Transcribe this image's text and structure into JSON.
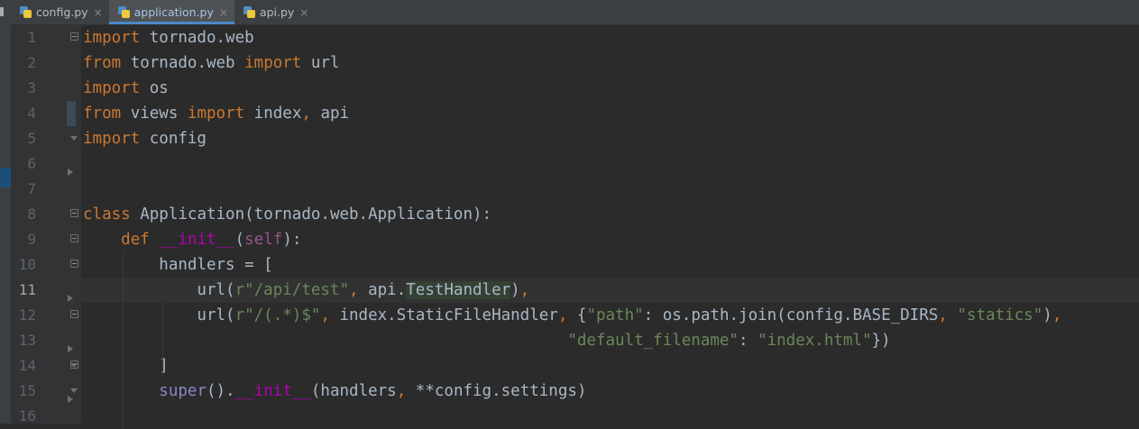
{
  "tabs": [
    {
      "label": "config.py",
      "active": false
    },
    {
      "label": "application.py",
      "active": true
    },
    {
      "label": "api.py",
      "active": false
    }
  ],
  "close_glyph": "×",
  "current_line": 11,
  "colors": {
    "keyword": "#cc7832",
    "string": "#6a8759",
    "self": "#94558d",
    "magic": "#b200b2",
    "builtin": "#8888c6",
    "default_text": "#a9b7c6",
    "background": "#2b2b2b",
    "gutter": "#313335"
  },
  "icons": {
    "file": "python-file-icon",
    "intention": "lightbulb-icon",
    "fold_open": "fold-open-icon",
    "fold_end": "fold-end-icon",
    "fold_collapse": "fold-arrow-icon"
  },
  "code_lines": [
    {
      "n": "1",
      "tokens": [
        {
          "t": "import",
          "c": "kw"
        },
        {
          "t": " tornado.web"
        }
      ]
    },
    {
      "n": "2",
      "tokens": [
        {
          "t": "from",
          "c": "kw"
        },
        {
          "t": " tornado.web "
        },
        {
          "t": "import",
          "c": "kw"
        },
        {
          "t": " url"
        }
      ]
    },
    {
      "n": "3",
      "tokens": [
        {
          "t": "import",
          "c": "kw"
        },
        {
          "t": " os"
        }
      ]
    },
    {
      "n": "4",
      "tokens": [
        {
          "t": "from",
          "c": "kw"
        },
        {
          "t": " views "
        },
        {
          "t": "import",
          "c": "kw"
        },
        {
          "t": " index"
        },
        {
          "t": ",",
          "c": "kw"
        },
        {
          "t": " api"
        }
      ]
    },
    {
      "n": "5",
      "tokens": [
        {
          "t": "import",
          "c": "kw"
        },
        {
          "t": " config"
        }
      ]
    },
    {
      "n": "6",
      "tokens": []
    },
    {
      "n": "7",
      "tokens": []
    },
    {
      "n": "8",
      "tokens": [
        {
          "t": "class",
          "c": "kw"
        },
        {
          "t": " Application(tornado.web.Application):"
        }
      ]
    },
    {
      "n": "9",
      "tokens": [
        {
          "t": "    "
        },
        {
          "t": "def",
          "c": "kw"
        },
        {
          "t": " "
        },
        {
          "t": "__init__",
          "c": "mag"
        },
        {
          "t": "("
        },
        {
          "t": "self",
          "c": "slf"
        },
        {
          "t": "):"
        }
      ]
    },
    {
      "n": "10",
      "tokens": [
        {
          "t": "        handlers = ["
        }
      ]
    },
    {
      "n": "11",
      "tokens": [
        {
          "t": "            url("
        },
        {
          "t": "r\"/api/test\"",
          "c": "str"
        },
        {
          "t": ",",
          "c": "kw"
        },
        {
          "t": " api."
        },
        {
          "t": "TestHandler",
          "c": "hl"
        },
        {
          "t": ")"
        },
        {
          "t": ",",
          "c": "kw"
        }
      ]
    },
    {
      "n": "12",
      "tokens": [
        {
          "t": "            url("
        },
        {
          "t": "r\"/(.*)$\"",
          "c": "str"
        },
        {
          "t": ",",
          "c": "kw"
        },
        {
          "t": " index.StaticFileHandler"
        },
        {
          "t": ",",
          "c": "kw"
        },
        {
          "t": " {"
        },
        {
          "t": "\"path\"",
          "c": "str"
        },
        {
          "t": ": os.path.join(config.BASE_DIRS"
        },
        {
          "t": ",",
          "c": "kw"
        },
        {
          "t": " "
        },
        {
          "t": "\"statics\"",
          "c": "str"
        },
        {
          "t": ")"
        },
        {
          "t": ",",
          "c": "kw"
        }
      ]
    },
    {
      "n": "13",
      "tokens": [
        {
          "t": "                                                   "
        },
        {
          "t": "\"default_filename\"",
          "c": "str"
        },
        {
          "t": ": "
        },
        {
          "t": "\"index.html\"",
          "c": "str"
        },
        {
          "t": "})"
        }
      ]
    },
    {
      "n": "14",
      "tokens": [
        {
          "t": "        ]"
        }
      ]
    },
    {
      "n": "15",
      "tokens": [
        {
          "t": "        "
        },
        {
          "t": "super",
          "c": "bi"
        },
        {
          "t": "()."
        },
        {
          "t": "__init__",
          "c": "mag"
        },
        {
          "t": "(handlers"
        },
        {
          "t": ",",
          "c": "kw"
        },
        {
          "t": " **config.settings)"
        }
      ]
    },
    {
      "n": "16",
      "tokens": []
    }
  ]
}
